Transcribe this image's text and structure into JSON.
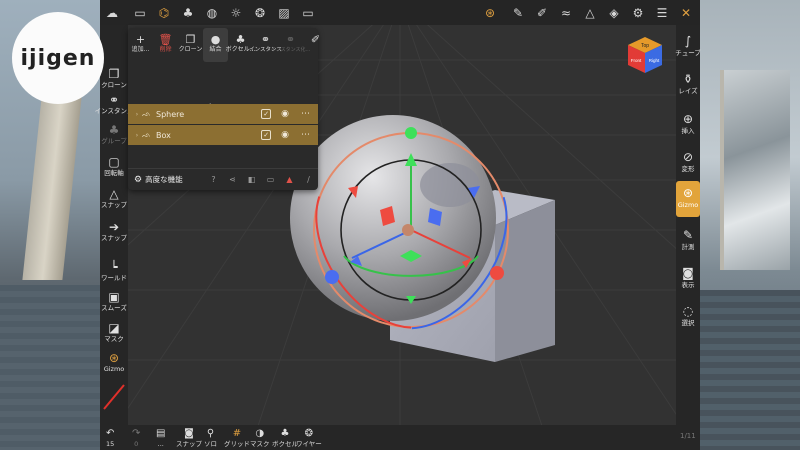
{
  "logo": {
    "text": "ijigen"
  },
  "top_toolbar": {
    "icons": [
      "menu-icon",
      "folder-icon",
      "graph-icon",
      "objects-icon",
      "globe-icon",
      "sun-icon",
      "material-icon",
      "image-icon",
      "video-icon"
    ],
    "right_icons": [
      "compass-icon",
      "pen-icon",
      "brush-icon",
      "sculpt-icon",
      "triangle-icon",
      "layers-icon",
      "settings-icon",
      "sliders-icon",
      "tools-icon"
    ]
  },
  "scene_panel": {
    "tools": [
      {
        "icon": "plus-icon",
        "label": "追加..."
      },
      {
        "icon": "trash-icon",
        "label": "削除"
      },
      {
        "icon": "clone-icon",
        "label": "クローン"
      },
      {
        "icon": "merge-icon",
        "label": "結合"
      },
      {
        "icon": "voxel-icon",
        "label": "ボクセル..."
      },
      {
        "icon": "link-icon",
        "label": "インスタンス"
      },
      {
        "icon": "unlink-icon",
        "label": "インスタンス化..."
      },
      {
        "icon": "pin-icon",
        "label": ""
      }
    ],
    "title": "シーン",
    "help": "?",
    "items": [
      {
        "name": "Sphere",
        "visible": true,
        "checked": true
      },
      {
        "name": "Box",
        "visible": true,
        "checked": true
      }
    ],
    "advanced_label": "高度な機能"
  },
  "left_toolbar": {
    "items": [
      {
        "icon": "clone-icon",
        "label": "クローン"
      },
      {
        "icon": "link-icon",
        "label": "インスタンス"
      },
      {
        "icon": "group-icon",
        "label": "グループ"
      },
      {
        "icon": "lock-icon",
        "label": "回転軸"
      },
      {
        "icon": "triangle-snap-icon",
        "label": "スナップ"
      },
      {
        "icon": "arrow-snap-icon",
        "label": "スナップ"
      },
      {
        "icon": "axis-icon",
        "label": "ワールド"
      },
      {
        "icon": "smooth-icon",
        "label": "スムーズ"
      },
      {
        "icon": "mask-icon",
        "label": "マスク"
      },
      {
        "icon": "gizmo-icon",
        "label": "Gizmo"
      }
    ]
  },
  "right_toolbar": {
    "items": [
      {
        "icon": "curve-icon",
        "label": "チューブ"
      },
      {
        "icon": "flask-icon",
        "label": "レイズ"
      },
      {
        "icon": "insert-icon",
        "label": "挿入"
      },
      {
        "icon": "deform-icon",
        "label": "変形"
      },
      {
        "icon": "gizmo-icon",
        "label": "Gizmo",
        "active": true
      },
      {
        "icon": "ruler-icon",
        "label": "計測"
      },
      {
        "icon": "camera-icon",
        "label": "表示"
      },
      {
        "icon": "select-icon",
        "label": "選択"
      }
    ]
  },
  "bottom_toolbar": {
    "undo_count": "15",
    "redo_count": "0",
    "items": [
      {
        "icon": "doc-icon",
        "label": "..."
      },
      {
        "icon": "snap-camera-icon",
        "label": "スナップ"
      },
      {
        "icon": "search-icon",
        "label": "ソロ"
      },
      {
        "icon": "grid-icon",
        "label": "グリッド"
      },
      {
        "icon": "mask-eye-icon",
        "label": "マスク"
      },
      {
        "icon": "voxel-icon",
        "label": "ボクセル"
      },
      {
        "icon": "wire-icon",
        "label": "ワイヤー"
      }
    ]
  },
  "navcube": {
    "top": "Top",
    "front": "Front",
    "right": "Right"
  },
  "page_number": "1/11",
  "colors": {
    "accent": "#e2a43b",
    "row_bg": "#8c6f32",
    "x_axis": "#e8413a",
    "y_axis": "#3ec94a",
    "z_axis": "#3a66e8"
  }
}
